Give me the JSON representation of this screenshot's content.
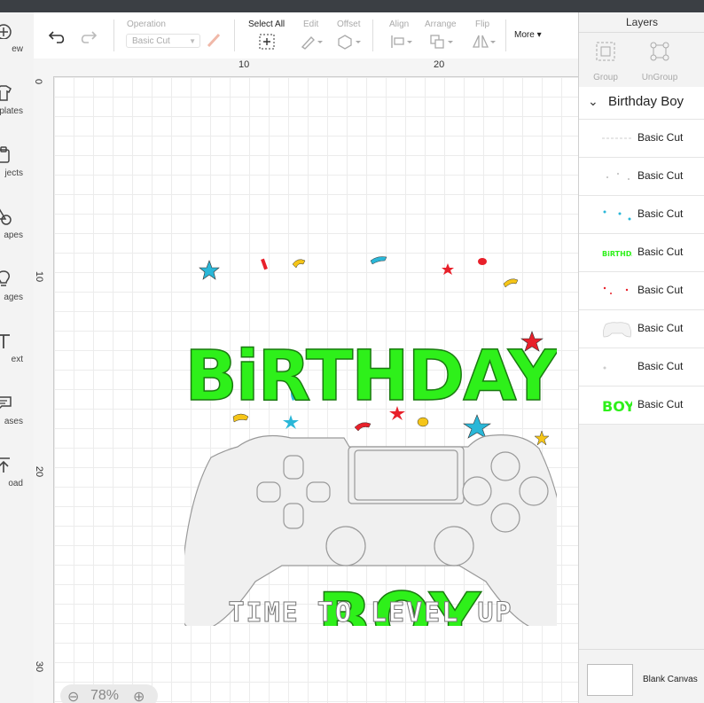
{
  "sidebar": {
    "items": [
      {
        "label": "New",
        "visible_label": "ew",
        "icon": "plus-circle-icon"
      },
      {
        "label": "Templates",
        "visible_label": "plates",
        "icon": "shirt-icon"
      },
      {
        "label": "Projects",
        "visible_label": "jects",
        "icon": "clipboard-icon"
      },
      {
        "label": "Shapes",
        "visible_label": "apes",
        "icon": "shapes-icon"
      },
      {
        "label": "Images",
        "visible_label": "ages",
        "icon": "lightbulb-icon"
      },
      {
        "label": "Text",
        "visible_label": "ext",
        "icon": "text-icon"
      },
      {
        "label": "Phrases",
        "visible_label": "ases",
        "icon": "speech-bubble-icon"
      },
      {
        "label": "Upload",
        "visible_label": "oad",
        "icon": "upload-icon"
      }
    ]
  },
  "toolbar": {
    "operation_label": "Operation",
    "operation_value": "Basic Cut",
    "select_all_label": "Select All",
    "edit_label": "Edit",
    "offset_label": "Offset",
    "align_label": "Align",
    "arrange_label": "Arrange",
    "flip_label": "Flip",
    "more_label": "More"
  },
  "canvas": {
    "ruler_top": [
      "10",
      "20"
    ],
    "ruler_left": [
      "0",
      "10",
      "20",
      "30"
    ],
    "zoom_value": "78%"
  },
  "design": {
    "title_top": "BiRTHDAY",
    "title_bottom": "BOY",
    "tagline": "TIME TO LEVEL UP",
    "colors": {
      "green": "#2ef01a",
      "outline": "#999999",
      "gray_fill": "#f0f0f0",
      "red": "#e8202a",
      "yellow": "#f5c518",
      "teal": "#2ab7d8"
    }
  },
  "layers": {
    "title": "Layers",
    "group_label": "Group",
    "ungroup_label": "UnGroup",
    "group_name": "Birthday Boy",
    "items": [
      {
        "name": "Basic Cut",
        "thumb": "line"
      },
      {
        "name": "Basic Cut",
        "thumb": "dots"
      },
      {
        "name": "Basic Cut",
        "thumb": "teal-dots"
      },
      {
        "name": "Basic Cut",
        "thumb": "birthday-text",
        "thumb_text": "BiRTHDAY"
      },
      {
        "name": "Basic Cut",
        "thumb": "red-dots"
      },
      {
        "name": "Basic Cut",
        "thumb": "controller"
      },
      {
        "name": "Basic Cut",
        "thumb": "dot"
      },
      {
        "name": "Basic Cut",
        "thumb": "boy-text",
        "thumb_text": "BOY"
      }
    ],
    "blank_canvas_label": "Blank Canvas"
  }
}
